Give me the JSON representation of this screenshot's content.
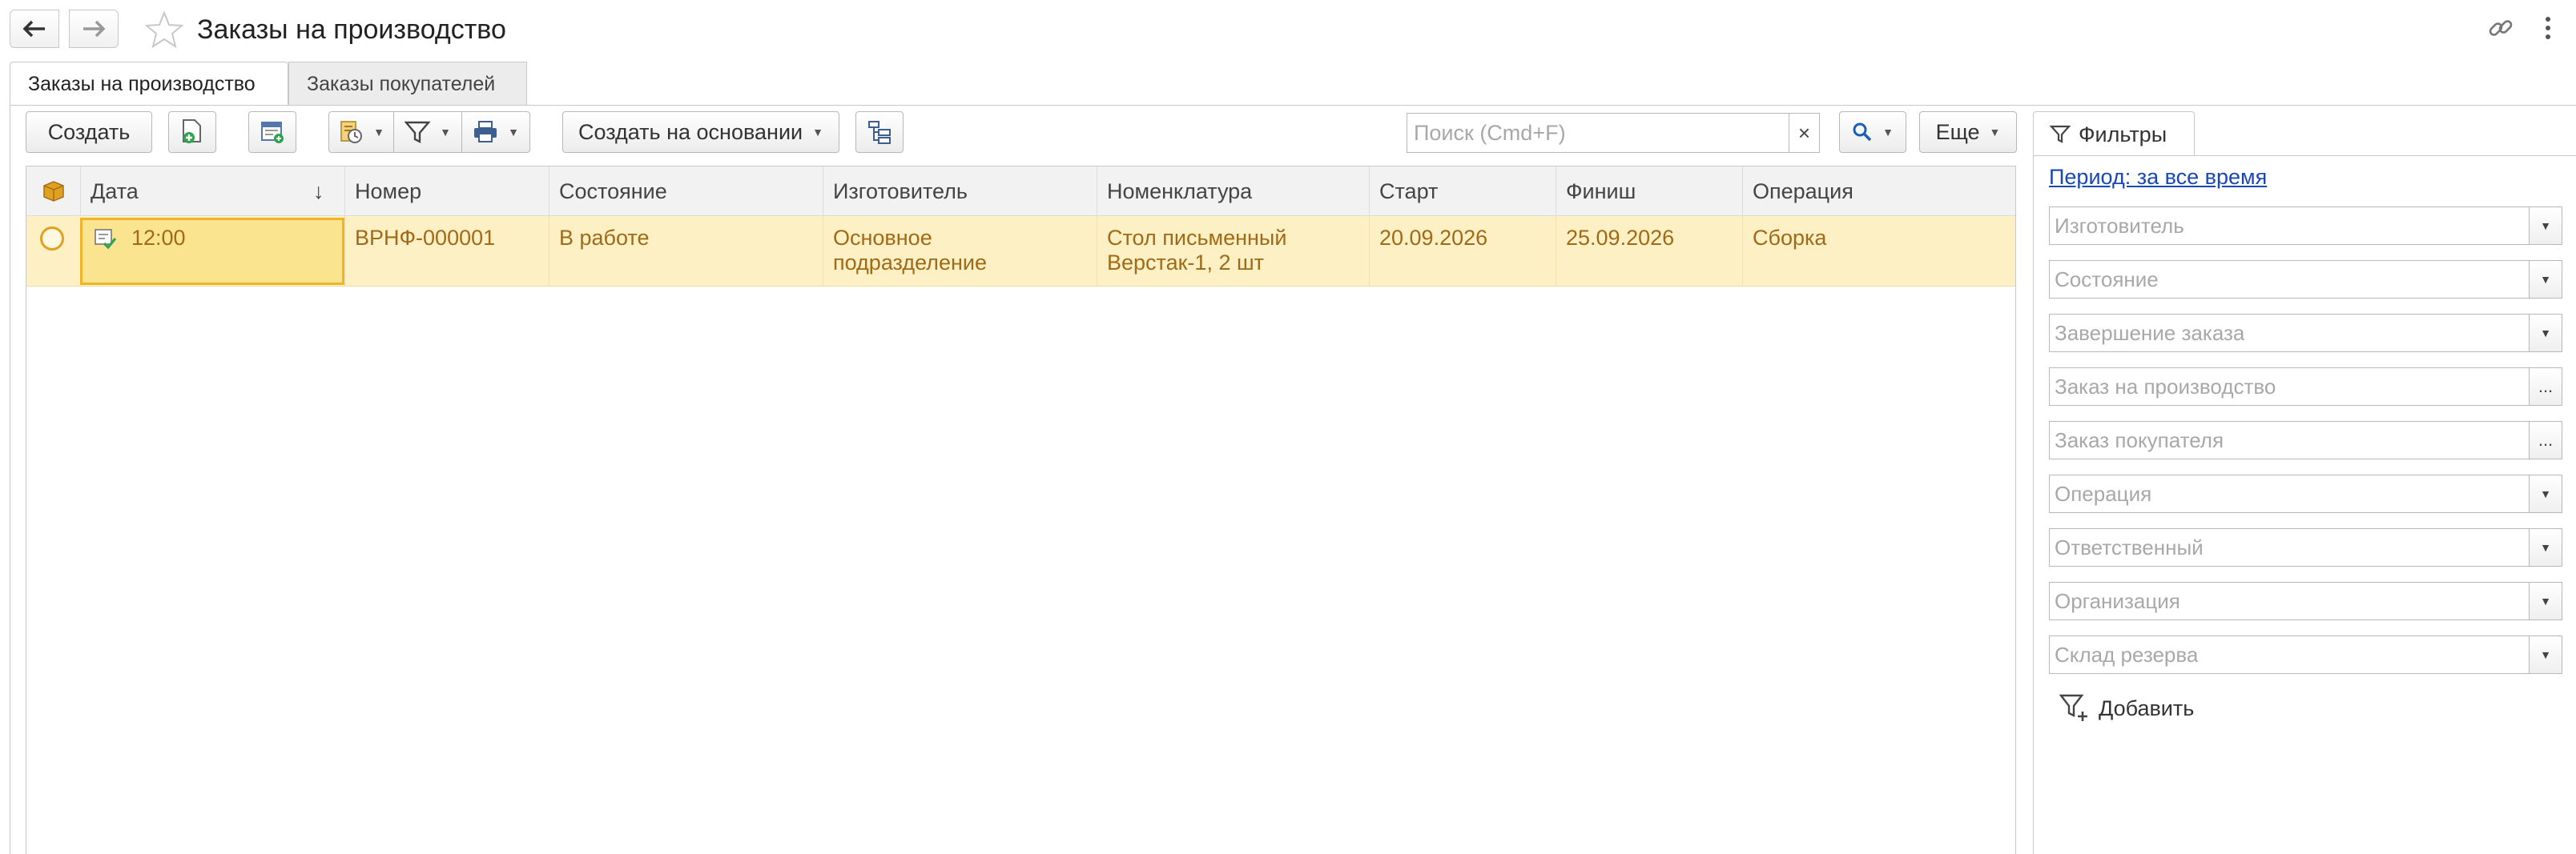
{
  "window": {
    "title": "Заказы на производство"
  },
  "tabs": [
    {
      "label": "Заказы на производство",
      "active": true
    },
    {
      "label": "Заказы покупателей",
      "active": false
    }
  ],
  "toolbar": {
    "create_label": "Создать",
    "create_based_label": "Создать на основании",
    "more_label": "Еще",
    "search_placeholder": "Поиск (Cmd+F)",
    "search_clear": "×"
  },
  "table": {
    "columns": [
      "Дата",
      "Номер",
      "Состояние",
      "Изготовитель",
      "Номенклатура",
      "Старт",
      "Финиш",
      "Операция"
    ],
    "sort_indicator": "↓",
    "rows": [
      {
        "date": "12:00",
        "number": "ВРНФ-000001",
        "state": "В работе",
        "manufacturer_line1": "Основное",
        "manufacturer_line2": "подразделение",
        "nomenclature_line1": "Стол письменный",
        "nomenclature_line2": "Верстак-1, 2 шт",
        "start": "20.09.2026",
        "finish": "25.09.2026",
        "operation": "Сборка"
      }
    ]
  },
  "filters": {
    "tab_label": "Фильтры",
    "period_link": "Период: за все время",
    "fields": [
      {
        "placeholder": "Изготовитель",
        "button": "dropdown"
      },
      {
        "placeholder": "Состояние",
        "button": "dropdown"
      },
      {
        "placeholder": "Завершение заказа",
        "button": "dropdown"
      },
      {
        "placeholder": "Заказ на производство",
        "button": "ellipsis"
      },
      {
        "placeholder": "Заказ покупателя",
        "button": "ellipsis"
      },
      {
        "placeholder": "Операция",
        "button": "dropdown"
      },
      {
        "placeholder": "Ответственный",
        "button": "dropdown"
      },
      {
        "placeholder": "Организация",
        "button": "dropdown"
      },
      {
        "placeholder": "Склад резерва",
        "button": "dropdown"
      }
    ],
    "ellipsis_glyph": "...",
    "add_label": "Добавить"
  },
  "colors": {
    "selected_row": "#fcf0c4",
    "selected_cell": "#fbe48f",
    "row_text": "#a06a16",
    "link": "#1a47b8"
  }
}
